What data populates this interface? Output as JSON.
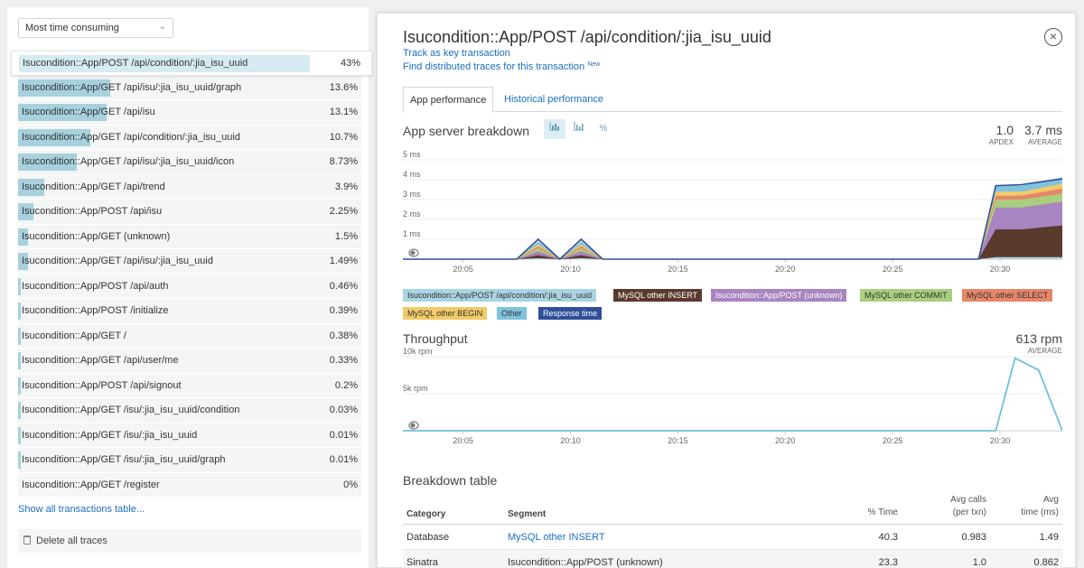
{
  "sort_select": {
    "value": "Most time consuming"
  },
  "transactions": [
    {
      "name": "Isucondition::App/POST /api/condition/:jia_isu_uuid",
      "pct": "43%",
      "fraction": 0.43,
      "selected": true
    },
    {
      "name": "Isucondition::App/GET /api/isu/:jia_isu_uuid/graph",
      "pct": "13.6%",
      "fraction": 0.136
    },
    {
      "name": "Isucondition::App/GET /api/isu",
      "pct": "13.1%",
      "fraction": 0.131
    },
    {
      "name": "Isucondition::App/GET /api/condition/:jia_isu_uuid",
      "pct": "10.7%",
      "fraction": 0.107
    },
    {
      "name": "Isucondition::App/GET /api/isu/:jia_isu_uuid/icon",
      "pct": "8.73%",
      "fraction": 0.0873
    },
    {
      "name": "Isucondition::App/GET /api/trend",
      "pct": "3.9%",
      "fraction": 0.039
    },
    {
      "name": "Isucondition::App/POST /api/isu",
      "pct": "2.25%",
      "fraction": 0.0225
    },
    {
      "name": "Isucondition::App/GET (unknown)",
      "pct": "1.5%",
      "fraction": 0.015
    },
    {
      "name": "Isucondition::App/GET /api/isu/:jia_isu_uuid",
      "pct": "1.49%",
      "fraction": 0.0149
    },
    {
      "name": "Isucondition::App/POST /api/auth",
      "pct": "0.46%",
      "fraction": 0.0046
    },
    {
      "name": "Isucondition::App/POST /initialize",
      "pct": "0.39%",
      "fraction": 0.0039
    },
    {
      "name": "Isucondition::App/GET /",
      "pct": "0.38%",
      "fraction": 0.0038
    },
    {
      "name": "Isucondition::App/GET /api/user/me",
      "pct": "0.33%",
      "fraction": 0.0033
    },
    {
      "name": "Isucondition::App/POST /api/signout",
      "pct": "0.2%",
      "fraction": 0.002
    },
    {
      "name": "Isucondition::App/GET /isu/:jia_isu_uuid/condition",
      "pct": "0.03%",
      "fraction": 0.0003
    },
    {
      "name": "Isucondition::App/GET /isu/:jia_isu_uuid",
      "pct": "0.01%",
      "fraction": 0.0001
    },
    {
      "name": "Isucondition::App/GET /isu/:jia_isu_uuid/graph",
      "pct": "0.01%",
      "fraction": 0.0001
    },
    {
      "name": "Isucondition::App/GET /register",
      "pct": "0%",
      "fraction": 0
    }
  ],
  "show_all_link": "Show all transactions table...",
  "delete_traces_label": "Delete all traces",
  "detail": {
    "title": "Isucondition::App/POST /api/condition/:jia_isu_uuid",
    "track_link": "Track as key transaction",
    "traces_link": "Find distributed traces for this transaction",
    "traces_badge": "New",
    "tabs": [
      {
        "label": "App performance",
        "active": true
      },
      {
        "label": "Historical performance",
        "active": false
      }
    ]
  },
  "breakdown_chart": {
    "title": "App server breakdown",
    "view_buttons": [
      "stacked-area-icon",
      "bar-chart-icon",
      "percent-icon"
    ],
    "view_button_percent": "%",
    "apdex_value": "1.0",
    "apdex_label": "APDEX",
    "avg_value": "3.7 ms",
    "avg_label": "AVERAGE"
  },
  "throughput_chart": {
    "title": "Throughput",
    "avg_value": "613 rpm",
    "avg_label": "AVERAGE"
  },
  "legend": [
    {
      "label": "Isucondition::App/POST /api/condition/:jia_isu_uuid",
      "color": "#a9d4e2",
      "text": "#333"
    },
    {
      "label": "MySQL other INSERT",
      "color": "#5b3a2e",
      "text": "#fff"
    },
    {
      "label": "Isucondition::App/POST (unknown)",
      "color": "#a884c0",
      "text": "#fff"
    },
    {
      "label": "MySQL other COMMIT",
      "color": "#a9cf7e",
      "text": "#333"
    },
    {
      "label": "MySQL other SELECT",
      "color": "#e8866a",
      "text": "#333"
    },
    {
      "label": "MySQL other BEGIN",
      "color": "#f2ca67",
      "text": "#333"
    },
    {
      "label": "Other",
      "color": "#7fc3df",
      "text": "#333"
    },
    {
      "label": "Response time",
      "color": "#2f4f9a",
      "text": "#fff"
    }
  ],
  "chart_data": [
    {
      "type": "area",
      "title": "App server breakdown",
      "ylabel": "",
      "xlabel": "",
      "ylim": [
        0,
        5
      ],
      "y_ticks": [
        "5 ms",
        "4 ms",
        "3 ms",
        "2 ms",
        "1 ms"
      ],
      "x_ticks": [
        "20:05",
        "20:10",
        "20:15",
        "20:20",
        "20:25",
        "20:30"
      ],
      "x_tick_minutes": [
        5,
        10,
        15,
        20,
        25,
        30
      ],
      "x_range_minutes": [
        2.2,
        32.9
      ],
      "x_minutes": [
        2.2,
        5,
        6.5,
        7.5,
        8.5,
        9.5,
        10.5,
        11.5,
        12.5,
        15,
        20,
        25,
        28.2,
        29,
        29.8,
        31,
        32.9
      ],
      "series": [
        {
          "name": "Isucondition::App/POST /api/condition/:jia_isu_uuid",
          "values": [
            0,
            0,
            0,
            0,
            0.05,
            0,
            0.05,
            0,
            0,
            0,
            0,
            0,
            0,
            0,
            0.1,
            0.1,
            0.1
          ]
        },
        {
          "name": "MySQL other INSERT",
          "values": [
            0,
            0,
            0,
            0,
            0.15,
            0,
            0.15,
            0,
            0,
            0,
            0,
            0,
            0,
            0,
            1.4,
            1.4,
            1.6
          ]
        },
        {
          "name": "Isucondition::App/POST (unknown)",
          "values": [
            0,
            0,
            0,
            0,
            0.2,
            0,
            0.2,
            0,
            0,
            0,
            0,
            0,
            0,
            0,
            1.1,
            1.1,
            1.2
          ]
        },
        {
          "name": "MySQL other COMMIT",
          "values": [
            0,
            0,
            0,
            0,
            0.15,
            0,
            0.15,
            0,
            0,
            0,
            0,
            0,
            0,
            0,
            0.4,
            0.4,
            0.4
          ]
        },
        {
          "name": "MySQL other SELECT",
          "values": [
            0,
            0,
            0,
            0,
            0.1,
            0,
            0.1,
            0,
            0,
            0,
            0,
            0,
            0,
            0,
            0.2,
            0.2,
            0.25
          ]
        },
        {
          "name": "MySQL other BEGIN",
          "values": [
            0,
            0,
            0,
            0,
            0.1,
            0,
            0.1,
            0,
            0,
            0,
            0,
            0,
            0,
            0,
            0.2,
            0.2,
            0.25
          ]
        },
        {
          "name": "Other",
          "values": [
            0,
            0,
            0,
            0,
            0.15,
            0,
            0.15,
            0,
            0,
            0,
            0,
            0,
            0,
            0,
            0.3,
            0.3,
            0.3
          ]
        }
      ],
      "response_time": {
        "name": "Response time",
        "values": [
          0,
          0,
          0,
          0,
          1.0,
          0,
          1.0,
          0,
          0,
          0,
          0,
          0,
          0,
          0,
          3.7,
          3.75,
          4.05
        ]
      }
    },
    {
      "type": "line",
      "title": "Throughput",
      "ylim": [
        0,
        10000
      ],
      "y_ticks": [
        "10k rpm",
        "5k rpm"
      ],
      "y_tick_values": [
        10000,
        5000
      ],
      "x_ticks": [
        "20:05",
        "20:10",
        "20:15",
        "20:20",
        "20:25",
        "20:30"
      ],
      "x_tick_minutes": [
        5,
        10,
        15,
        20,
        25,
        30
      ],
      "x_range_minutes": [
        2.2,
        32.9
      ],
      "series": [
        {
          "name": "Throughput",
          "x_minutes": [
            2.2,
            29.8,
            30.7,
            31.8,
            32.9
          ],
          "values": [
            0,
            0,
            9800,
            8200,
            0
          ]
        }
      ]
    }
  ],
  "breakdown_table": {
    "title": "Breakdown table",
    "headers": {
      "category": "Category",
      "segment": "Segment",
      "time": "% Time",
      "calls_1": "Avg calls",
      "calls_2": "(per txn)",
      "avg_1": "Avg",
      "avg_2": "time (ms)"
    },
    "rows": [
      {
        "category": "Database",
        "segment": "MySQL other INSERT",
        "segment_link": true,
        "time": "40.3",
        "calls": "0.983",
        "avg": "1.49"
      },
      {
        "category": "Sinatra",
        "segment": "Isucondition::App/POST (unknown)",
        "segment_link": false,
        "time": "23.3",
        "calls": "1.0",
        "avg": "0.862"
      }
    ]
  }
}
